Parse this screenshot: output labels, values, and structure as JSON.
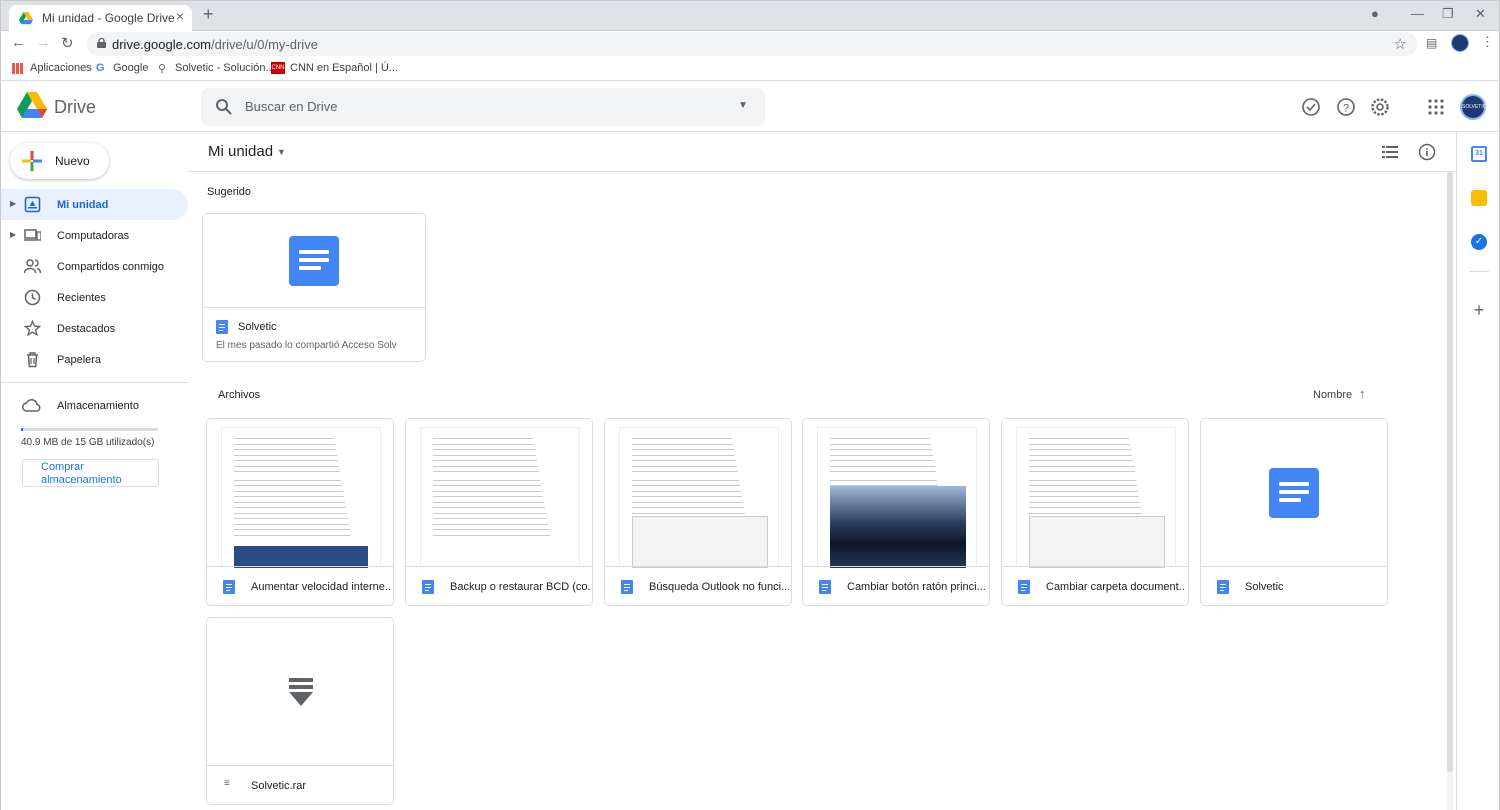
{
  "browser": {
    "tab_title": "Mi unidad - Google Drive",
    "url_host": "drive.google.com",
    "url_path": "/drive/u/0/my-drive",
    "bookmarks": [
      "Aplicaciones",
      "Google",
      "Solvetic - Solución...",
      "CNN en Español | Ú..."
    ]
  },
  "header": {
    "app_name": "Drive",
    "search_placeholder": "Buscar en Drive",
    "avatar_text": "SOLVETIC"
  },
  "sidebar": {
    "new_label": "Nuevo",
    "items": [
      {
        "label": "Mi unidad",
        "icon": "my-drive-icon"
      },
      {
        "label": "Computadoras",
        "icon": "computer-icon"
      },
      {
        "label": "Compartidos conmigo",
        "icon": "people-icon"
      },
      {
        "label": "Recientes",
        "icon": "clock-icon"
      },
      {
        "label": "Destacados",
        "icon": "star-icon"
      },
      {
        "label": "Papelera",
        "icon": "trash-icon"
      }
    ],
    "storage_label": "Almacenamiento",
    "storage_used": "40.9 MB de 15 GB utilizado(s)",
    "storage_fraction": 0.003,
    "buy_label": "Comprar almacenamiento"
  },
  "main": {
    "breadcrumb": "Mi unidad",
    "suggested_title": "Sugerido",
    "suggested": {
      "name": "Solvetic",
      "subtitle": "El mes pasado lo compartió Acceso Solv"
    },
    "files_title": "Archivos",
    "sort_label": "Nombre",
    "files": [
      {
        "name": "Aumentar velocidad interne...",
        "thumb": "doc-page"
      },
      {
        "name": "Backup o restaurar BCD (co...",
        "thumb": "doc-page"
      },
      {
        "name": "Búsqueda Outlook no funci...",
        "thumb": "doc-page-screenshot"
      },
      {
        "name": "Cambiar botón ratón princi...",
        "thumb": "doc-page-photo"
      },
      {
        "name": "Cambiar carpeta document...",
        "thumb": "doc-page-screenshot"
      },
      {
        "name": "Solvetic",
        "thumb": "doc-icon"
      },
      {
        "name": "Solvetic.rar",
        "thumb": "archive-icon"
      }
    ]
  },
  "colors": {
    "accent": "#1a73e8",
    "doc_blue": "#4285f4",
    "active_bg": "#e8f0fe"
  }
}
